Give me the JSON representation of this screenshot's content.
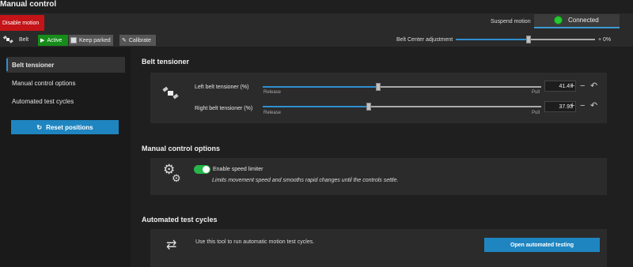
{
  "window": {
    "title": "Manual control"
  },
  "toolbar": {
    "disable_label": "Disable motion",
    "suspend_label": "Suspend motion",
    "status_text": "Connected",
    "belt_label": "Belt",
    "active_label": "Active",
    "keep_parked_label": "Keep parked",
    "calibrate_label": "Calibrate",
    "center_adjust_label": "Belt Center adjustment",
    "center_adjust_value_text": "+ 0%",
    "center_adjust_value": 0.52
  },
  "sidebar": {
    "items": [
      {
        "label": "Belt tensioner"
      },
      {
        "label": "Manual control options"
      },
      {
        "label": "Automated test cycles"
      }
    ],
    "reset_label": "Reset positions"
  },
  "belt_tensioner": {
    "title": "Belt tensioner",
    "release_label": "Release",
    "pull_label": "Pull",
    "left": {
      "label": "Left belt tensioner (%)",
      "value": "41.47"
    },
    "right": {
      "label": "Right belt tensioner (%)",
      "value": "37.93"
    }
  },
  "manual_options": {
    "title": "Manual control options",
    "toggle_label": "Enable speed limiter",
    "toggle_on": true,
    "description": "Limits movement speed and smooths rapid changes until the controls settle."
  },
  "test_cycles": {
    "title": "Automated test cycles",
    "text": "Use this tool to run automatic motion test cycles.",
    "button_label": "Open automated testing"
  },
  "colors": {
    "accent": "#1f85c0",
    "danger": "#c41418",
    "success": "#27c832"
  }
}
